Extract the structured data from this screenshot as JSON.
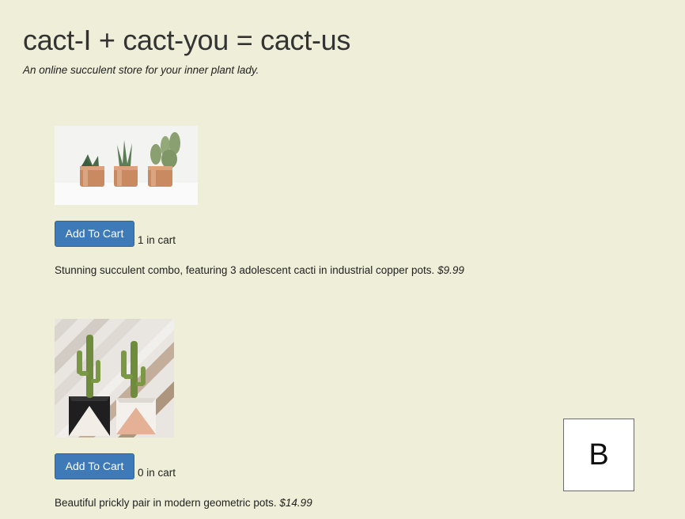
{
  "header": {
    "title": "cact-I + cact-you = cact-us",
    "subtitle": "An online succulent store for your inner plant lady."
  },
  "products": [
    {
      "image_label": "three cacti in copper pots",
      "button_label": "Add To Cart",
      "cart_count_text": "1 in cart",
      "description": "Stunning succulent combo, featuring 3 adolescent cacti in industrial copper pots.",
      "price": "$9.99"
    },
    {
      "image_label": "two cacti in geometric pots",
      "button_label": "Add To Cart",
      "cart_count_text": "0 in cart",
      "description": "Beautiful prickly pair in modern geometric pots.",
      "price": "$14.99"
    }
  ],
  "floating_box": {
    "label": "B"
  },
  "colors": {
    "background": "#efeed8",
    "button": "#3f7ab8",
    "copper": "#c98a62"
  }
}
